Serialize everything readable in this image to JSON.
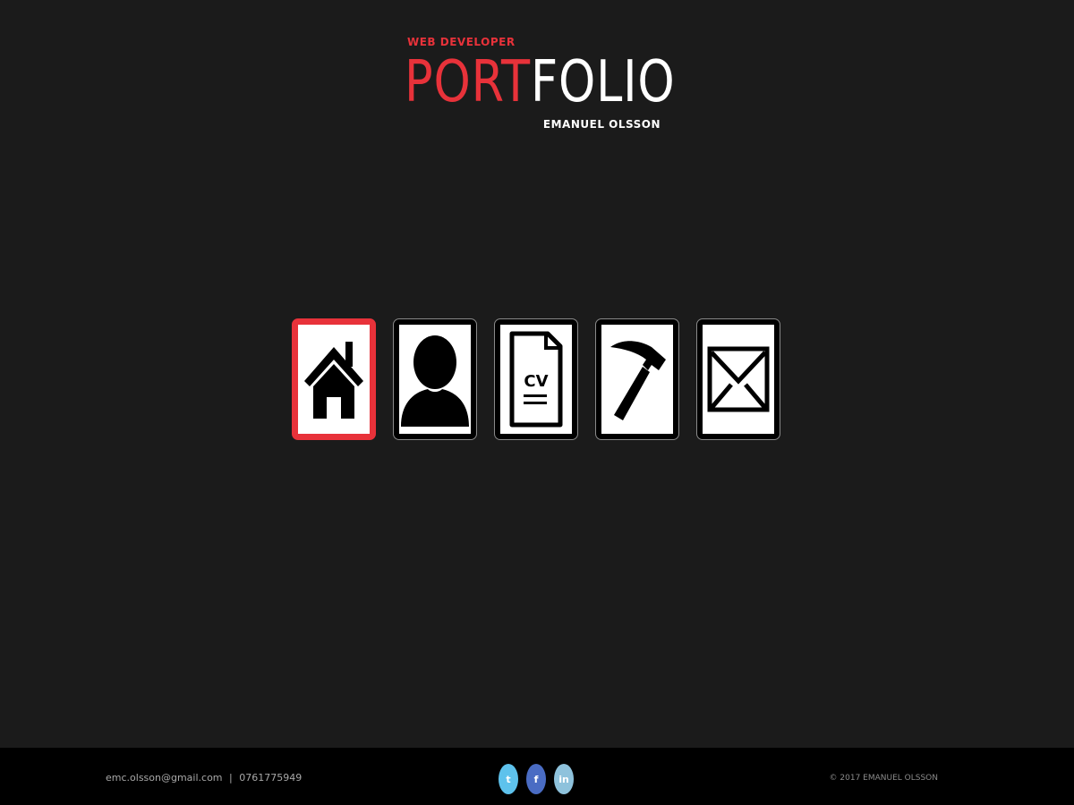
{
  "logo": {
    "subtitle": "WEB DEVELOPER",
    "title_red": "PORT",
    "title_white": "FOLIO",
    "author": "EMANUEL OLSSON"
  },
  "nav": {
    "items": [
      {
        "icon": "home-icon",
        "active": true
      },
      {
        "icon": "person-icon",
        "active": false
      },
      {
        "icon": "cv-document-icon",
        "active": false,
        "label": "CV"
      },
      {
        "icon": "hammer-icon",
        "active": false
      },
      {
        "icon": "envelope-icon",
        "active": false
      }
    ]
  },
  "footer": {
    "email": "emc.olsson@gmail.com",
    "separator": "|",
    "phone": "0761775949",
    "social": [
      {
        "icon": "twitter-icon",
        "glyph": "t",
        "color": "#5ec2ec"
      },
      {
        "icon": "facebook-icon",
        "glyph": "f",
        "color": "#4a6cc3"
      },
      {
        "icon": "linkedin-icon",
        "glyph": "in",
        "color": "#8ec2dc"
      }
    ],
    "copyright": "© 2017 EMANUEL OLSSON"
  },
  "colors": {
    "accent": "#e8323a",
    "background": "#1b1b1b",
    "footer_background": "#000000"
  }
}
